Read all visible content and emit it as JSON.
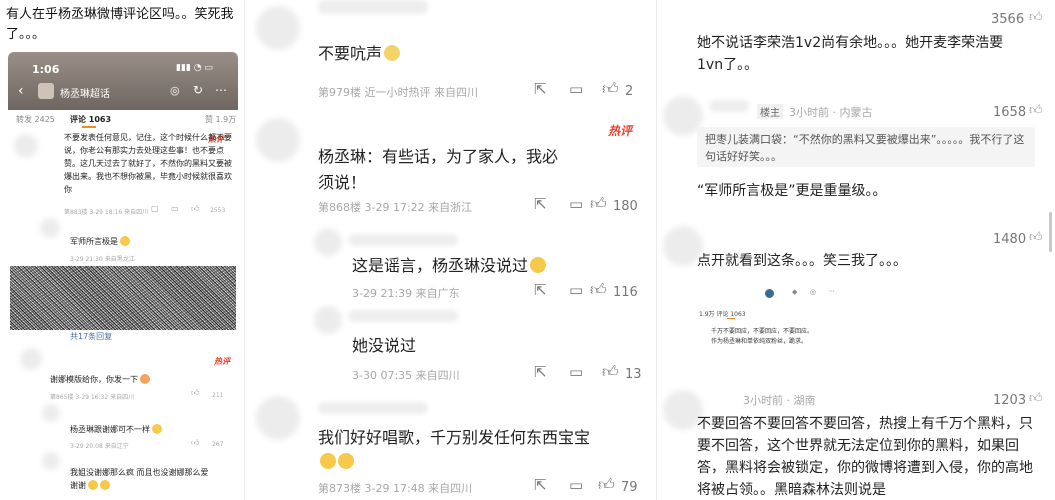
{
  "left": {
    "post_title": "有人在乎杨丞琳微博评论区吗。。笑死我了。。。",
    "phone_time": "1:06",
    "topic": "杨丞琳超话",
    "tab_repost": "转发 2425",
    "tab_comment": "评论 1063",
    "tab_like": "赞 1.9万",
    "c1_text": "不要发表任何意见，记住，这个时候什么都不要说，你老公有那实力去处理这些事！也不要点赞。这几天过去了就好了，不然你的黑料又要被爆出来。我也不想你被黑，毕竟小时候就很喜欢你",
    "c1_meta": "第883楼 3-29 18:16 来自四川",
    "c1_likes": "2553",
    "c2_text": "军师所言极是",
    "c2_meta": "3-29 21:30 来自黑龙江",
    "replies": "共17条回复",
    "hot_tag": "热评",
    "c3_text": "谢娜模版给你，你发一下",
    "c3_meta": "第865楼 3-29 16:32 来自四川",
    "c3_likes": "211",
    "c4_text": "杨丞琳跟谢娜可不一样",
    "c4_meta": "3-29 20:08 来自辽宁",
    "c4_likes": "267",
    "c5_text": "我姐没谢娜那么疯 而且也没谢娜那么爱 谢谢"
  },
  "middle": {
    "c1_text": "不要吭声",
    "c1_meta": "第979楼 近一小时热评 来自四川",
    "c1_likes": "2",
    "hot_tag": "热评",
    "c2_text": "杨丞琳：有些话，为了家人，我必须说！",
    "c2_meta": "第868楼 3-29 17:22 来自浙江",
    "c2_likes": "180",
    "c3_text": "这是谣言，杨丞琳没说过",
    "c3_meta": "3-29 21:39 来自广东",
    "c3_likes": "116",
    "c4_text": "她没说过",
    "c4_meta": "3-30 07:35 来自四川",
    "c4_likes": "13",
    "c5_text": "我们好好唱歌，千万别发任何东西宝宝",
    "c5_meta": "第873楼 3-29 17:48 来自四川",
    "c5_likes": "79"
  },
  "right": {
    "top_likes": "3566",
    "c1_text": "她不说话李荣浩1v2尚有余地。。。她开麦李荣浩要1vn了。。",
    "op_tag": "楼主",
    "c2_meta": "3小时前 · 内蒙古",
    "c2_likes": "1658",
    "c2_quote": "把枣儿装满口袋：“不然你的黑料又要被爆出来”。。。。。我不行了这句话好好笑。。。",
    "c2_text": "“军师所言极是”更是重量级。。",
    "c3_likes": "1480",
    "c3_text": "点开就看到这条。。。笑三我了。。。",
    "mini_tabs": "1.9万  评论 1063",
    "mini_text1": "千万不要回应，不要回应，不要回应。",
    "mini_text2": "作为杨丞琳和单依纯双粉丝，跪求。",
    "c4_meta": "3小时前 · 湖南",
    "c4_likes": "1203",
    "c4_text": "不要回答不要回答不要回答，热搜上有千万个黑料，只要不回答，这个世界就无法定位到你的黑料，如果回答，黑料将会被锁定，你的微博将遭到入侵，你的高地将被占领。。黑暗森林法则说是"
  }
}
